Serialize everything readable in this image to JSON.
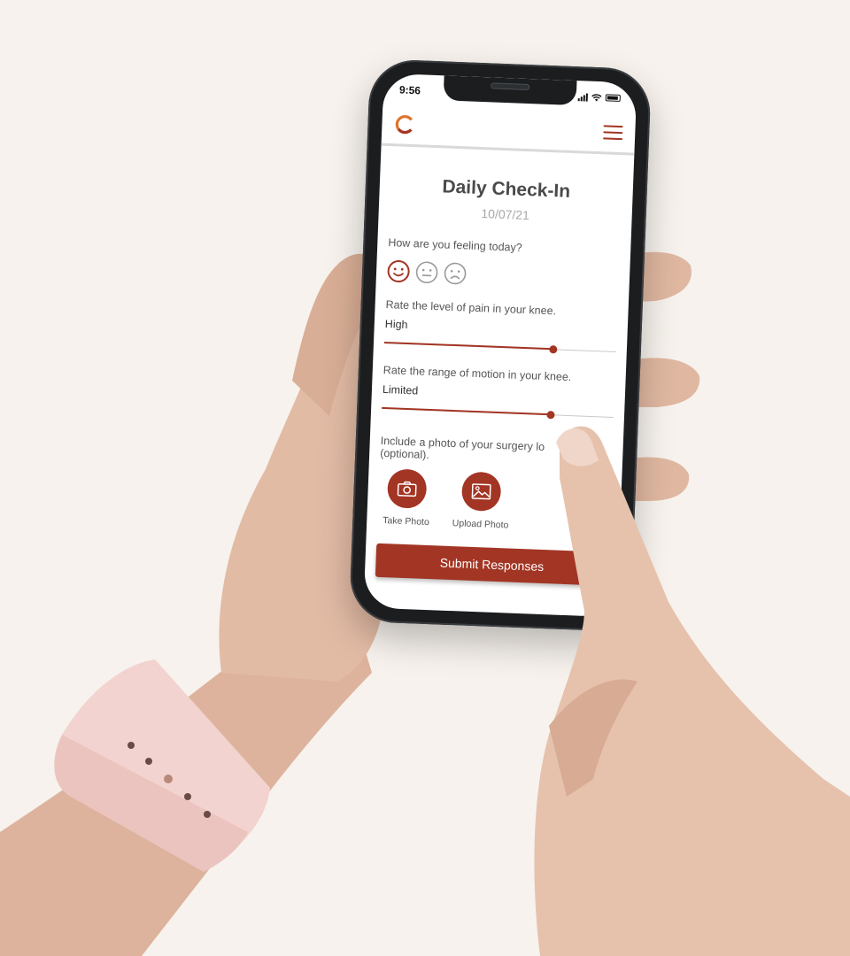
{
  "status_bar": {
    "time": "9:56"
  },
  "header": {
    "logo_icon": "circle-logo-icon",
    "menu_icon": "hamburger-menu-icon"
  },
  "checkin": {
    "title": "Daily Check-In",
    "date": "10/07/21",
    "feeling_question": "How are you feeling today?",
    "moods": [
      {
        "icon": "happy-face-icon",
        "selected": true
      },
      {
        "icon": "neutral-face-icon",
        "selected": false
      },
      {
        "icon": "sad-face-icon",
        "selected": false
      }
    ],
    "pain_question": "Rate the level of pain in your knee.",
    "pain_level_label": "High",
    "pain_value": 0.73,
    "motion_question": "Rate the range of motion in your knee.",
    "motion_level_label": "Limited",
    "motion_value": 0.73,
    "photo_question": "Include a photo of your surgery lo",
    "photo_question_optional": "(optional).",
    "take_photo_label": "Take Photo",
    "upload_photo_label": "Upload Photo",
    "submit_label": "Submit Responses"
  },
  "colors": {
    "accent": "#a33524",
    "background": "#f7f2ed",
    "title_text": "#4a4a4a",
    "muted_text": "#a8a8a8",
    "logo_orange": "#e0732c"
  }
}
